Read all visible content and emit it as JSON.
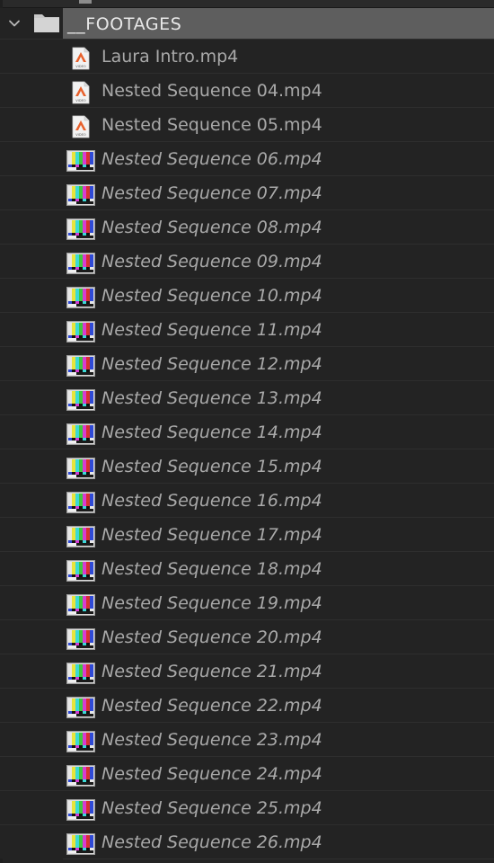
{
  "bin": {
    "folder_name": "__FOOTAGES",
    "expanded": true,
    "items": [
      {
        "name": "Laura Intro.mp4",
        "icon": "video-file-icon",
        "status": "online"
      },
      {
        "name": "Nested Sequence 04.mp4",
        "icon": "video-file-icon",
        "status": "online"
      },
      {
        "name": "Nested Sequence 05.mp4",
        "icon": "video-file-icon",
        "status": "online"
      },
      {
        "name": "Nested Sequence 06.mp4",
        "icon": "color-bars-icon",
        "status": "offline"
      },
      {
        "name": "Nested Sequence 07.mp4",
        "icon": "color-bars-icon",
        "status": "offline"
      },
      {
        "name": "Nested Sequence 08.mp4",
        "icon": "color-bars-icon",
        "status": "offline"
      },
      {
        "name": "Nested Sequence 09.mp4",
        "icon": "color-bars-icon",
        "status": "offline"
      },
      {
        "name": "Nested Sequence 10.mp4",
        "icon": "color-bars-icon",
        "status": "offline"
      },
      {
        "name": "Nested Sequence 11.mp4",
        "icon": "color-bars-icon",
        "status": "offline"
      },
      {
        "name": "Nested Sequence 12.mp4",
        "icon": "color-bars-icon",
        "status": "offline"
      },
      {
        "name": "Nested Sequence 13.mp4",
        "icon": "color-bars-icon",
        "status": "offline"
      },
      {
        "name": "Nested Sequence 14.mp4",
        "icon": "color-bars-icon",
        "status": "offline"
      },
      {
        "name": "Nested Sequence 15.mp4",
        "icon": "color-bars-icon",
        "status": "offline"
      },
      {
        "name": "Nested Sequence 16.mp4",
        "icon": "color-bars-icon",
        "status": "offline"
      },
      {
        "name": "Nested Sequence 17.mp4",
        "icon": "color-bars-icon",
        "status": "offline"
      },
      {
        "name": "Nested Sequence 18.mp4",
        "icon": "color-bars-icon",
        "status": "offline"
      },
      {
        "name": "Nested Sequence 19.mp4",
        "icon": "color-bars-icon",
        "status": "offline"
      },
      {
        "name": "Nested Sequence 20.mp4",
        "icon": "color-bars-icon",
        "status": "offline"
      },
      {
        "name": "Nested Sequence 21.mp4",
        "icon": "color-bars-icon",
        "status": "offline"
      },
      {
        "name": "Nested Sequence 22.mp4",
        "icon": "color-bars-icon",
        "status": "offline"
      },
      {
        "name": "Nested Sequence 23.mp4",
        "icon": "color-bars-icon",
        "status": "offline"
      },
      {
        "name": "Nested Sequence 24.mp4",
        "icon": "color-bars-icon",
        "status": "offline"
      },
      {
        "name": "Nested Sequence 25.mp4",
        "icon": "color-bars-icon",
        "status": "offline"
      },
      {
        "name": "Nested Sequence 26.mp4",
        "icon": "color-bars-icon",
        "status": "offline"
      }
    ]
  },
  "video_badge_text": "VIDEO",
  "colors": {
    "panel_bg": "#232323",
    "folder_highlight": "#5e5e5e",
    "label_text": "#a9a9a9",
    "folder_text": "#e8e8e8",
    "video_badge": "#e8612c"
  }
}
